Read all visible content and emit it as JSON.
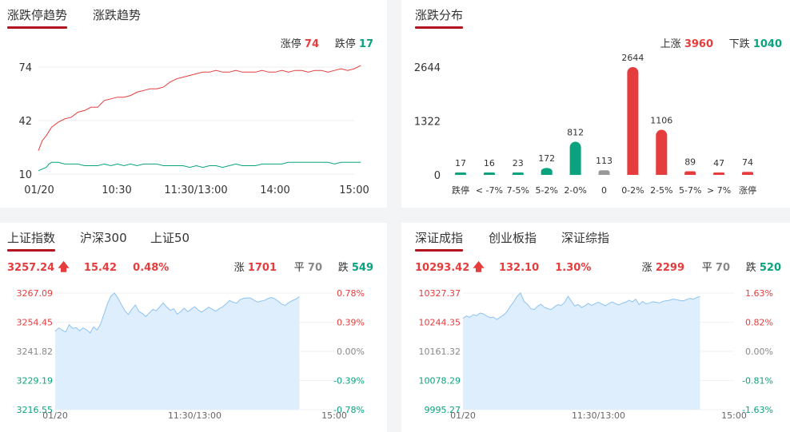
{
  "limit_trend": {
    "tabs": [
      "涨跌停趋势",
      "涨跌趋势"
    ],
    "limit_up_label": "涨停",
    "limit_up_value": "74",
    "limit_down_label": "跌停",
    "limit_down_value": "17",
    "colors": {
      "up": "#e53d3d",
      "down": "#0ba37f"
    }
  },
  "distribution": {
    "tab": "涨跌分布",
    "rise_label": "上涨",
    "rise_value": "3960",
    "fall_label": "下跌",
    "fall_value": "1040"
  },
  "sh_index": {
    "tabs": [
      "上证指数",
      "沪深300",
      "上证50"
    ],
    "price": "3257.24",
    "change": "15.42",
    "change_pct": "0.48%",
    "rise_label": "涨",
    "rise_value": "1701",
    "flat_label": "平",
    "flat_value": "70",
    "fall_label": "跌",
    "fall_value": "549"
  },
  "sz_index": {
    "tabs": [
      "深证成指",
      "创业板指",
      "深证综指"
    ],
    "price": "10293.42",
    "change": "132.10",
    "change_pct": "1.30%",
    "rise_label": "涨",
    "rise_value": "2299",
    "flat_label": "平",
    "flat_value": "70",
    "fall_label": "跌",
    "fall_value": "520"
  },
  "chart_data": [
    {
      "type": "line",
      "x_ticks": [
        "01/20",
        "10:30",
        "11:30/13:00",
        "14:00",
        "15:00"
      ],
      "y_ticks": [
        "74",
        "42",
        "10"
      ],
      "ylim": [
        10,
        74
      ],
      "x_sessions": 240,
      "series": [
        {
          "name": "涨停",
          "color": "#e53d3d",
          "x": [
            0,
            3,
            6,
            10,
            15,
            20,
            25,
            30,
            35,
            40,
            45,
            50,
            55,
            60,
            65,
            70,
            75,
            80,
            85,
            90,
            95,
            100,
            105,
            110,
            115,
            120,
            125,
            130,
            135,
            140,
            145,
            150,
            155,
            160,
            165,
            170,
            175,
            180,
            185,
            190,
            195,
            200,
            205,
            210,
            215,
            220,
            225,
            230,
            235,
            240,
            245
          ],
          "values": [
            24,
            30,
            33,
            38,
            41,
            43,
            44,
            47,
            48,
            50,
            50,
            54,
            55,
            56,
            56,
            57,
            59,
            60,
            61,
            61,
            62,
            65,
            67,
            68,
            69,
            70,
            71,
            71,
            72,
            71,
            71,
            72,
            71,
            71,
            71,
            72,
            71,
            71,
            72,
            71,
            72,
            72,
            71,
            72,
            72,
            71,
            72,
            73,
            72,
            73,
            75
          ]
        },
        {
          "name": "跌停",
          "color": "#0ba37f",
          "x": [
            0,
            3,
            6,
            8,
            10,
            15,
            20,
            25,
            30,
            35,
            40,
            45,
            50,
            55,
            60,
            65,
            70,
            75,
            80,
            85,
            90,
            95,
            100,
            105,
            110,
            115,
            120,
            125,
            130,
            135,
            140,
            145,
            150,
            155,
            160,
            165,
            170,
            175,
            180,
            185,
            190,
            195,
            200,
            205,
            210,
            215,
            220,
            225,
            230,
            235,
            240,
            245
          ],
          "values": [
            12,
            13,
            14,
            16,
            17,
            17,
            16,
            16,
            16,
            15,
            15,
            15,
            16,
            15,
            16,
            15,
            16,
            15,
            16,
            16,
            16,
            15,
            15,
            15,
            15,
            14,
            15,
            14,
            15,
            15,
            14,
            15,
            16,
            15,
            15,
            15,
            16,
            16,
            16,
            16,
            17,
            17,
            17,
            17,
            17,
            17,
            17,
            16,
            17,
            17,
            17,
            17
          ]
        }
      ]
    },
    {
      "type": "bar",
      "categories": [
        "跌停",
        "< -7%",
        "7-5%",
        "5-2%",
        "2-0%",
        "0",
        "0-2%",
        "2-5%",
        "5-7%",
        "> 7%",
        "涨停"
      ],
      "values": [
        17,
        16,
        23,
        172,
        812,
        113,
        2644,
        1106,
        89,
        47,
        74
      ],
      "colors": [
        "#0ba37f",
        "#0ba37f",
        "#0ba37f",
        "#0ba37f",
        "#0ba37f",
        "#999999",
        "#e53d3d",
        "#e53d3d",
        "#e53d3d",
        "#e53d3d",
        "#e53d3d"
      ],
      "y_ticks": [
        "2644",
        "1322",
        "0"
      ],
      "ylim": [
        0,
        2644
      ]
    },
    {
      "type": "area",
      "y_ticks_left": [
        "3267.09",
        "3254.45",
        "3241.82",
        "3229.19",
        "3216.55"
      ],
      "y_ticks_right": [
        "0.78%",
        "0.39%",
        "0.00%",
        "-0.39%",
        "-0.78%"
      ],
      "x_ticks": [
        "01/20",
        "11:30/13:00",
        "15:00"
      ],
      "ylim": [
        3216.55,
        3267.09
      ],
      "x": [
        0,
        3,
        6,
        9,
        12,
        15,
        18,
        21,
        24,
        27,
        30,
        33,
        36,
        39,
        42,
        45,
        48,
        51,
        54,
        57,
        60,
        63,
        66,
        69,
        72,
        75,
        78,
        81,
        84,
        87,
        90,
        93,
        96,
        99,
        102,
        105,
        108,
        111,
        114,
        117,
        120,
        123,
        126,
        129,
        132,
        135,
        138,
        141,
        144,
        147,
        150,
        153,
        156,
        159,
        162,
        165,
        168,
        171,
        174,
        177,
        180,
        183,
        186,
        189,
        192,
        195,
        198,
        201,
        204,
        207,
        210
      ],
      "values": [
        3250.5,
        3252.0,
        3251.0,
        3250.2,
        3253.4,
        3251.8,
        3252.1,
        3250.7,
        3252.0,
        3251.2,
        3249.8,
        3252.4,
        3251.1,
        3253.6,
        3258.0,
        3262.5,
        3265.8,
        3267.1,
        3264.9,
        3262.0,
        3259.4,
        3257.8,
        3260.2,
        3261.9,
        3259.1,
        3258.2,
        3256.9,
        3258.5,
        3260.0,
        3259.4,
        3261.2,
        3262.8,
        3261.0,
        3259.6,
        3260.3,
        3257.9,
        3259.1,
        3260.5,
        3259.0,
        3260.1,
        3261.2,
        3259.7,
        3258.8,
        3259.9,
        3261.0,
        3260.1,
        3259.2,
        3260.3,
        3261.1,
        3262.4,
        3263.9,
        3263.1,
        3262.7,
        3264.2,
        3264.8,
        3265.0,
        3264.9,
        3264.0,
        3263.2,
        3263.6,
        3263.9,
        3264.7,
        3265.1,
        3264.6,
        3263.5,
        3262.2,
        3261.8,
        3263.0,
        3263.8,
        3264.5,
        3265.5
      ],
      "x_total": 240
    },
    {
      "type": "area",
      "y_ticks_left": [
        "10327.37",
        "10244.35",
        "10161.32",
        "10078.29",
        "9995.27"
      ],
      "y_ticks_right": [
        "1.63%",
        "0.82%",
        "0.00%",
        "-0.81%",
        "-1.63%"
      ],
      "x_ticks": [
        "01/20",
        "11:30/13:00",
        "15:00"
      ],
      "ylim": [
        9995.27,
        10327.37
      ],
      "x": [
        0,
        3,
        6,
        9,
        12,
        15,
        18,
        21,
        24,
        27,
        30,
        33,
        36,
        39,
        42,
        45,
        48,
        51,
        54,
        57,
        60,
        63,
        66,
        69,
        72,
        75,
        78,
        81,
        84,
        87,
        90,
        93,
        96,
        99,
        102,
        105,
        108,
        111,
        114,
        117,
        120,
        123,
        126,
        129,
        132,
        135,
        138,
        141,
        144,
        147,
        150,
        153,
        156,
        159,
        162,
        165,
        168,
        171,
        174,
        177,
        180,
        183,
        186,
        189,
        192,
        195,
        198,
        201,
        204,
        207,
        210
      ],
      "values": [
        10255.0,
        10262.1,
        10258.3,
        10266.0,
        10262.7,
        10270.4,
        10268.2,
        10262.0,
        10257.3,
        10258.8,
        10252.1,
        10259.0,
        10264.7,
        10274.5,
        10289.7,
        10302.6,
        10318.2,
        10327.4,
        10303.9,
        10295.6,
        10283.0,
        10280.2,
        10289.4,
        10295.6,
        10287.2,
        10283.0,
        10280.2,
        10288.0,
        10294.3,
        10292.1,
        10300.8,
        10318.3,
        10304.0,
        10290.6,
        10294.8,
        10286.4,
        10291.3,
        10297.9,
        10292.3,
        10297.1,
        10301.4,
        10296.3,
        10291.0,
        10297.4,
        10301.8,
        10297.6,
        10293.4,
        10298.2,
        10301.2,
        10306.8,
        10302.6,
        10309.9,
        10294.3,
        10303.8,
        10297.0,
        10298.4,
        10302.6,
        10301.2,
        10299.1,
        10303.8,
        10305.5,
        10307.0,
        10310.4,
        10308.2,
        10306.5,
        10305.0,
        10308.7,
        10312.3,
        10310.1,
        10314.6,
        10317.9
      ],
      "x_total": 240
    }
  ]
}
